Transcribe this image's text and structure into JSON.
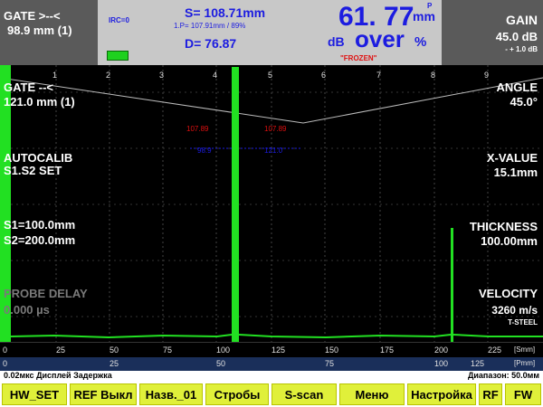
{
  "top": {
    "gate_label": "GATE >--<",
    "gate_value": "98.9 mm (1)",
    "irc": "IRC=0",
    "s_value": "S= 108.71mm",
    "p_value": "1.P= 107.91mm / 89%",
    "d_value": "D= 76.87",
    "amplitude_value": "61. 77",
    "amplitude_unit": "mm",
    "amplitude_sup": "P",
    "db_label": "dB",
    "over_label": "over",
    "percent_label": "%",
    "frozen": "\"FROZEN\"",
    "gain_label": "GAIN",
    "gain_value": "45.0 dB",
    "gain_step": "- + 1.0 dB"
  },
  "left": {
    "gate2_label": "GATE --<",
    "gate2_value": "121.0 mm (1)",
    "autocalib_label": "AUTOCALIB",
    "autocalib_value": "S1.S2 SET",
    "s1": "S1=100.0mm",
    "s2": "S2=200.0mm",
    "probe_delay_label": "PROBE DELAY",
    "probe_delay_value": "0.000 µs"
  },
  "right": {
    "angle_label": "ANGLE",
    "angle_value": "45.0°",
    "xvalue_label": "X-VALUE",
    "xvalue_value": "15.1mm",
    "thickness_label": "THICKNESS",
    "thickness_value": "100.00mm",
    "velocity_label": "VELOCITY",
    "velocity_value": "3260 m/s",
    "material": "T-STEEL"
  },
  "plot": {
    "grid_numbers": [
      "1",
      "2",
      "3",
      "4",
      "5",
      "6",
      "7",
      "8",
      "9"
    ],
    "marker_red_1": "107.89",
    "marker_red_2": "107.89",
    "marker_blue_1": "98.9",
    "marker_blue_2": "121.0"
  },
  "scale1": {
    "ticks": [
      "0",
      "25",
      "50",
      "75",
      "100",
      "125",
      "150",
      "175",
      "200",
      "225"
    ],
    "unit": "[Smm]"
  },
  "scale2": {
    "ticks": [
      "0",
      "25",
      "50",
      "75",
      "100",
      "125"
    ],
    "unit": "[Pmm]"
  },
  "status": {
    "left": "0.02мкс  Дисплей Задержка",
    "right": "Диапазон:  50.0мм"
  },
  "softkeys": [
    "HW_SET",
    "REF Выкл",
    "Назв._01",
    "Стробы",
    "S-scan",
    "Меню",
    "Настройка",
    "RF",
    "FW"
  ],
  "colors": {
    "signal": "#22e022",
    "key_bg": "#e0f03a",
    "value_blue": "#1c1ce0",
    "frozen_red": "#e01010"
  }
}
